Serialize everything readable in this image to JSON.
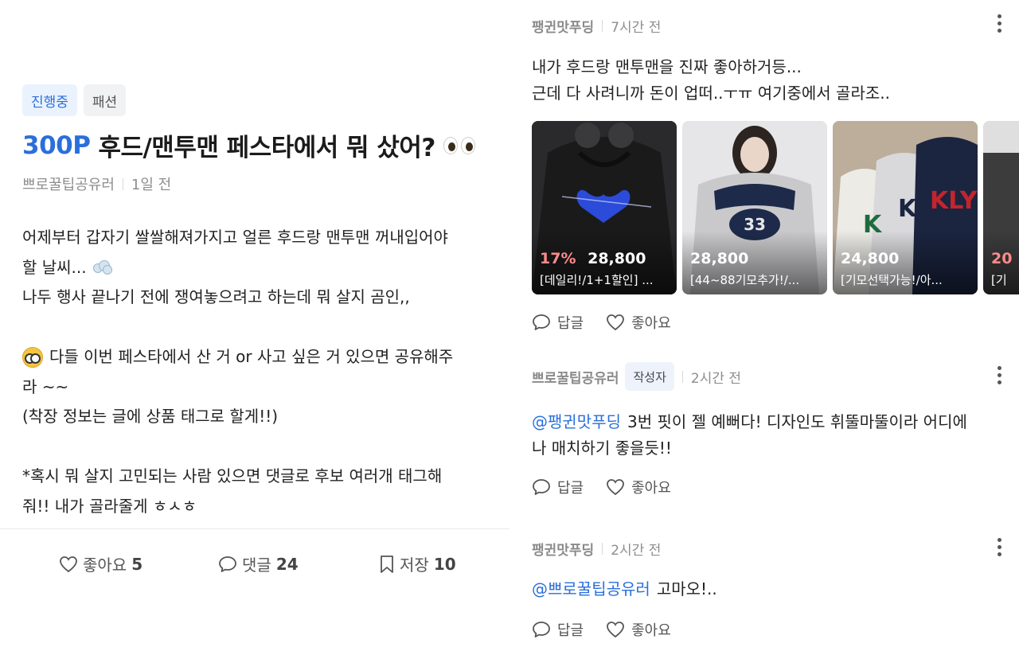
{
  "post": {
    "status_tag": "진행중",
    "category_tag": "패션",
    "point": "300P",
    "title": "후드/맨투맨 페스타에서 뭐 샀어?",
    "title_emoji": "eyes-emoji",
    "author": "쁘로꿀팁공유러",
    "time": "1일 전",
    "body_lines": [
      "어제부터 갑자기 쌀쌀해져가지고 얼른 후드랑 맨투맨 꺼내입어야",
      "할 날씨...",
      "나두 행사 끝나기 전에 쟁여놓으려고 하는데 뭐 살지 곰인,,",
      "",
      "다들 이번 페스타에서 산 거 or 사고 싶은 거 있으면 공유해주",
      "라 ~~",
      "(착장 정보는 글에 상품 태그로 할게!!)",
      "",
      "*혹시 뭐 살지 고민되는 사람 있으면 댓글로 후보 여러개 태그해",
      "줘!! 내가 골라줄게 ㅎㅅㅎ"
    ],
    "actions": {
      "like_label": "좋아요",
      "like_count": "5",
      "comment_label": "댓글",
      "comment_count": "24",
      "save_label": "저장",
      "save_count": "10"
    }
  },
  "comments": [
    {
      "author": "팽귄맛푸딩",
      "time": "7시간 전",
      "lines": [
        "내가 후드랑 맨투맨을 진짜 좋아하거등...",
        "근데 다 사려니까 돈이 업떠..ㅜㅠ 여기중에서 골라조.."
      ],
      "products": [
        {
          "discount": "17%",
          "price": "28,800",
          "name": "[데일리!/1+1할인] ..."
        },
        {
          "discount": "",
          "price": "28,800",
          "name": "[44~88기모추가!/..."
        },
        {
          "discount": "",
          "price": "24,800",
          "name": "[기모선택가능!/아..."
        },
        {
          "discount": "20",
          "price": "",
          "name": "[기"
        }
      ],
      "reply_label": "답글",
      "like_label": "좋아요"
    },
    {
      "author": "쁘로꿀팁공유러",
      "badge": "작성자",
      "time": "2시간 전",
      "mention": "@팽귄맛푸딩",
      "lines": [
        "3번 핏이 젤 예뻐다! 디자인도 휘뚤마뚤이라 어디에",
        "나 매치하기 좋을듯!!"
      ],
      "reply_label": "답글",
      "like_label": "좋아요"
    },
    {
      "author": "팽귄맛푸딩",
      "time": "2시간 전",
      "mention": "@쁘로꿀팁공유러",
      "lines": [
        "고마오!.."
      ],
      "reply_label": "답글",
      "like_label": "좋아요"
    }
  ],
  "colors": {
    "accent": "#2a6fdb",
    "muted": "#8e8e8e",
    "text": "#222222"
  }
}
